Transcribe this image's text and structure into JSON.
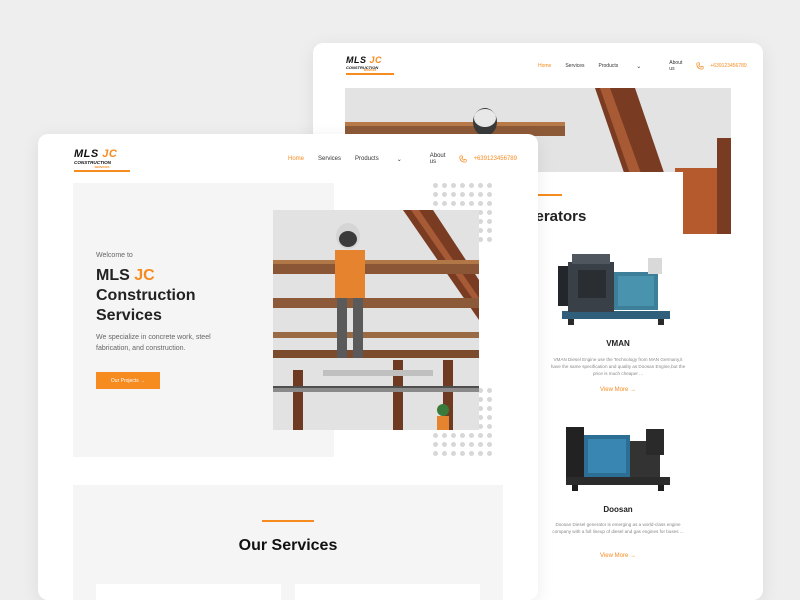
{
  "brand": {
    "name_main": "MLS",
    "name_accent": "JC",
    "name_line2": "CONSTRUCTION",
    "name_line3": "SERVICES"
  },
  "colors": {
    "accent": "#f68b1f",
    "text": "#222222",
    "muted": "#888888",
    "background": "#eeeeee"
  },
  "nav": {
    "home": "Home",
    "services": "Services",
    "products": "Products",
    "about": "About us",
    "phone": "+639123456789",
    "phone_icon": "phone-icon",
    "dropdown_icon": "chevron-down-icon"
  },
  "back_page": {
    "section_title": "enerators",
    "products": [
      {
        "name": "VMAN",
        "description": "VMAN Diesel Engine use the Technology from MAN Germany,it have the same specification and quality as Doosan Engine,but the price is much cheaper ...",
        "link": "View More →"
      },
      {
        "name": "Doosan",
        "description": "Doosan Diesel generator is emerging as a world-class engine company with a full lineup of diesel and gas engines for buses ...",
        "link": "View More →"
      }
    ]
  },
  "front_page": {
    "hero": {
      "welcome": "Welcome to",
      "title_main": "MLS",
      "title_accent": "JC",
      "title_line2": "Construction",
      "title_line3": "Services",
      "lead": "We specialize in concrete work, steel fabrication, and construction.",
      "cta": "Our Projects →"
    },
    "services": {
      "title": "Our Services"
    }
  }
}
